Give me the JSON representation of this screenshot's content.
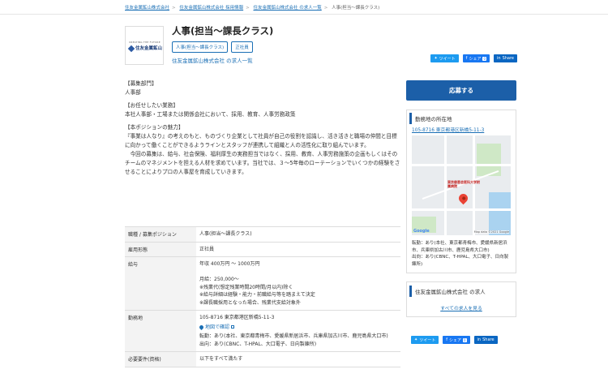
{
  "breadcrumb": [
    "住友金属鉱山株式会社",
    "住友金属鉱山株式会社 採用情報",
    "住友金属鉱山株式会社 の求人一覧",
    "人事(担当〜課長クラス)"
  ],
  "logo": {
    "small_text": "CREATING THE FUTURE",
    "name": "住友金属鉱山"
  },
  "job": {
    "title": "人事(担当〜課長クラス)",
    "tags": [
      "人事(担当〜課長クラス)",
      "正社員"
    ],
    "company_link": "住友金属鉱山株式会社 の求人一覧"
  },
  "share": {
    "tweet": "ツイート",
    "facebook": "シェア",
    "facebook_count": "0",
    "linkedin": "Share"
  },
  "description": [
    "【募集部門】\n人事部",
    "【お任せしたい業務】\n本社人事部・工場または関係会社において、採用、教育、人事労務政策",
    "【本ポジションの魅力】\n『事業は人なり』の考えのもと、ものづくり企業として社員が自己の役割を認識し、活き活きと職場の仲間と目標に向かって働くことができるようラインとスタッフが連携して組織と人の活性化に取り組んでいます。\n　今回の募集は、給与、社会保険、福利厚生の実務担当ではなく、採用、教育、人事労務施策の企画もしくはそのチームのマネジメントを担える人材を求めています。当社では、３～5年毎のローテーションでいくつかの経験をさせることによりプロの人事屋を育成していきます。"
  ],
  "table": [
    {
      "label": "職種 / 募集ポジション",
      "value": "人事(担当〜課長クラス)"
    },
    {
      "label": "雇用形態",
      "value": "正社員"
    },
    {
      "label": "給与",
      "value": "年収 400万円 〜 1000万円\n\n月給：250,000～\n※残業代(想定残業時間20時間/月以内)除く\n※給与詳細は経験・能力・前職給与等を踏まえて決定\n※課長職採用となった場合、残業代支給対象外"
    },
    {
      "label": "勤務地",
      "value": "105-8716  東京都港区新橋5-11-3",
      "map_link": "地図で確認",
      "extra": "転勤：あり(本社、東京都青梅市、愛媛県新居浜市、兵庫県加古川市、鹿児島県大口市)\n出向：あり(CBNC、T-HPAL、大口電子、日向製錬所)"
    },
    {
      "label": "必要要件(資格)",
      "value": "以下をすべて満たす"
    }
  ],
  "sidebar": {
    "apply_label": "応募する",
    "location_heading": "勤務地の所在地",
    "address": "105-8716  東京都港区新橋5-11-3",
    "map_labels": [
      "東京慈恵会医科大学附属病院",
      "Google",
      "Map data ©2021 Google"
    ],
    "access": "転勤：あり(本社、東京都青梅市、愛媛県新居浜市、兵庫県加古川市、鹿児島県大口市)\n出向：あり(CBNC、T-HPAL、大口電子、日向製錬所)",
    "company_heading": "住友金属鉱山株式会社 の求人",
    "company_all_link": "すべての求人を見る"
  }
}
